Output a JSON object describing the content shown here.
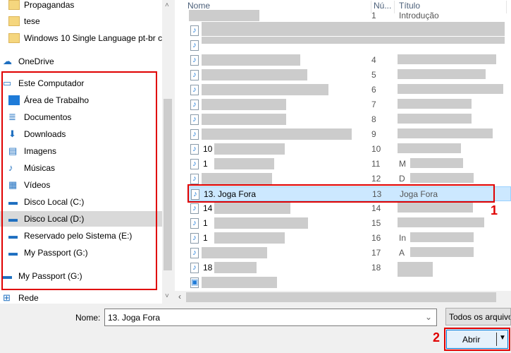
{
  "nav": {
    "items": [
      {
        "label": "Propagandas",
        "icon": "folder-icon"
      },
      {
        "label": "tese",
        "icon": "folder-icon"
      },
      {
        "label": "Windows 10 Single Language pt-br co",
        "icon": "folder-icon"
      },
      {
        "label": "OneDrive",
        "icon": "cloud-icon"
      },
      {
        "label": "Este Computador",
        "icon": "computer-icon"
      },
      {
        "label": "Área de Trabalho",
        "icon": "desktop-icon"
      },
      {
        "label": "Documentos",
        "icon": "document-icon"
      },
      {
        "label": "Downloads",
        "icon": "download-icon"
      },
      {
        "label": "Imagens",
        "icon": "image-icon"
      },
      {
        "label": "Músicas",
        "icon": "music-icon"
      },
      {
        "label": "Vídeos",
        "icon": "video-icon"
      },
      {
        "label": "Disco Local (C:)",
        "icon": "drive-icon"
      },
      {
        "label": "Disco Local (D:)",
        "icon": "drive-icon",
        "selected": true
      },
      {
        "label": "Reservado pelo Sistema (E:)",
        "icon": "drive-icon"
      },
      {
        "label": "My Passport (G:)",
        "icon": "drive-icon"
      },
      {
        "label": "My Passport (G:)",
        "icon": "drive-icon"
      },
      {
        "label": "Rede",
        "icon": "network-icon"
      }
    ]
  },
  "columns": {
    "name": "Nome",
    "number": "Nú...",
    "title": "Título"
  },
  "files": [
    {
      "name": "",
      "number": "1",
      "title": "Introdução"
    },
    {
      "name": "",
      "number": "",
      "title": ""
    },
    {
      "name": "",
      "number": "",
      "title": ""
    },
    {
      "name": "",
      "number": "4",
      "title": ""
    },
    {
      "name": "",
      "number": "5",
      "title": ""
    },
    {
      "name": "",
      "number": "6",
      "title": ""
    },
    {
      "name": "",
      "number": "7",
      "title": ""
    },
    {
      "name": "",
      "number": "8",
      "title": ""
    },
    {
      "name": "",
      "number": "9",
      "title": ""
    },
    {
      "name": "10",
      "number": "10",
      "title": ""
    },
    {
      "name": "1",
      "number": "11",
      "title": "M"
    },
    {
      "name": "",
      "number": "12",
      "title": "D"
    },
    {
      "name": "13. Joga Fora",
      "number": "13",
      "title": "Joga Fora",
      "selected": true
    },
    {
      "name": "14",
      "number": "14",
      "title": ""
    },
    {
      "name": "1",
      "number": "15",
      "title": ""
    },
    {
      "name": "1",
      "number": "16",
      "title": "In"
    },
    {
      "name": "",
      "number": "17",
      "title": "A"
    },
    {
      "name": "18",
      "number": "18",
      "title": ""
    },
    {
      "name": "",
      "number": "",
      "title": ""
    }
  ],
  "footer": {
    "name_label": "Nome:",
    "name_value": "13. Joga Fora",
    "filter": "Todos os arquivo",
    "open": "Abrir"
  },
  "annotations": {
    "step1": "1",
    "step2": "2"
  },
  "colors": {
    "highlight": "#e00000",
    "selection": "#cce8ff"
  }
}
